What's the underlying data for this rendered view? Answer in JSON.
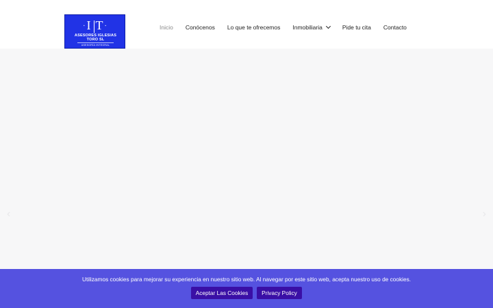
{
  "logo": {
    "mark_left": "I",
    "mark_right": "T",
    "name_line1": "ASESORES IGLESIAS",
    "name_line2": "TORO SL",
    "tagline": "ASESORÍA INTEGRAL",
    "color": "#2133e6"
  },
  "nav": {
    "items": [
      {
        "label": "Inicio",
        "active": true
      },
      {
        "label": "Conócenos"
      },
      {
        "label": "Lo que te ofrecemos"
      },
      {
        "label": "Inmobiliaria",
        "has_dropdown": true,
        "icon": "chevron-down-icon"
      },
      {
        "label": "Pide tu cita"
      },
      {
        "label": "Contacto"
      }
    ]
  },
  "slider": {
    "prev_icon": "chevron-left-icon",
    "next_icon": "chevron-right-icon",
    "prev_glyph": "‹",
    "next_glyph": "›"
  },
  "cookie_bar": {
    "message": "Utilizamos cookies para mejorar su experiencia en nuestro sitio web. Al navegar por este sitio web, acepta nuestro uso de cookies.",
    "accept_label": "Aceptar Las Cookies",
    "privacy_label": "Privacy Policy",
    "background_color": "#5552e0",
    "button_color": "#3a0fa6"
  }
}
